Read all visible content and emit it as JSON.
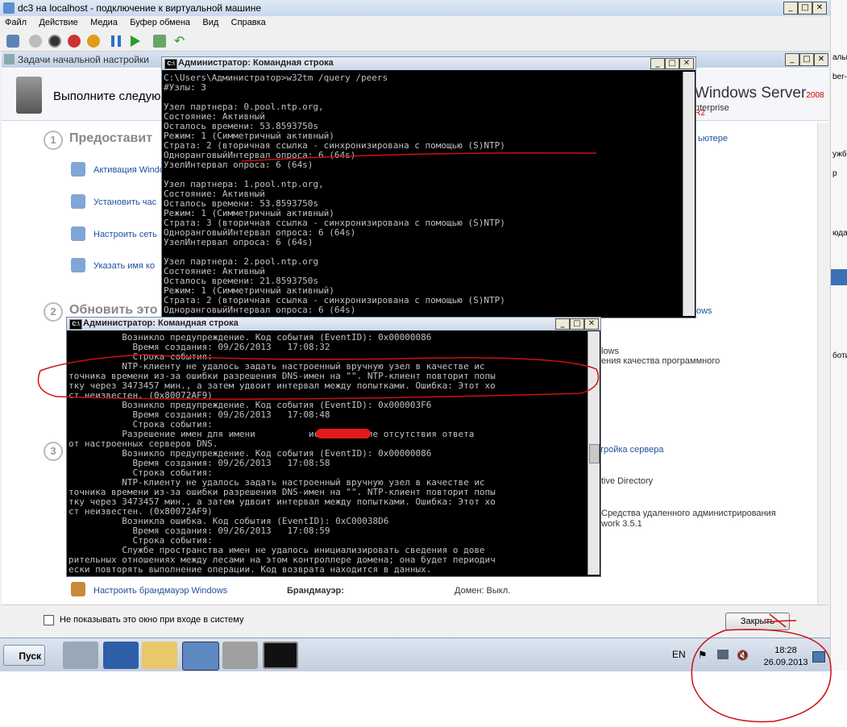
{
  "vm": {
    "title": "dc3 на localhost - подключение к виртуальной машине",
    "menu": [
      "Файл",
      "Действие",
      "Медиа",
      "Буфер обмена",
      "Вид",
      "Справка"
    ]
  },
  "ict": {
    "title": "Задачи начальной настройки",
    "header": "Выполните следую",
    "logo": "Windows Server",
    "logo_ver": "2008 R2",
    "edition": "nterprise",
    "section1": {
      "num": "1",
      "title": "Предоставит"
    },
    "tasks": [
      "Активация Windo",
      "Установить час",
      "Настроить сеть",
      "Указать имя ко"
    ],
    "computer_link": "ьютере",
    "section2": {
      "num": "2",
      "title": "Обновить это"
    },
    "section3": {
      "num": "3"
    },
    "right_items": [
      "ows",
      "lows",
      "ения качества программного",
      "тройка сервера",
      "tive Directory",
      "Средства удаленного администрирования",
      "work 3.5.1"
    ],
    "firewall_link": "Настроить брандмауэр Windows",
    "firewall_label": "Брандмауэр:",
    "firewall_value": "Домен: Выкл.",
    "dont_show": "Не показывать это окно при входе в систему",
    "close_button": "Закрыть"
  },
  "cmd1": {
    "title": "Администратор: Командная строка",
    "lines": [
      "C:\\Users\\Администратор>w32tm /query /peers",
      "#Узлы: 3",
      "",
      "Узел партнера: 0.pool.ntp.org,",
      "Состояние: Активный",
      "Осталось времени: 53.8593750s",
      "Режим: 1 (Симметричный активный)",
      "Страта: 2 (вторичная ссылка - синхронизирована с помощью (S)NTP)",
      "ОдноранговыйИнтервал опроса: 6 (64s)",
      "УзелИнтервал опроса: 6 (64s)",
      "",
      "Узел партнера: 1.pool.ntp.org,",
      "Состояние: Активный",
      "Осталось времени: 53.8593750s",
      "Режим: 1 (Симметричный активный)",
      "Страта: 3 (вторичная ссылка - синхронизирована с помощью (S)NTP)",
      "ОдноранговыйИнтервал опроса: 6 (64s)",
      "УзелИнтервал опроса: 6 (64s)",
      "",
      "Узел партнера: 2.pool.ntp.org",
      "Состояние: Активный",
      "Осталось времени: 21.8593750s",
      "Режим: 1 (Симметричный активный)",
      "Страта: 2 (вторичная ссылка - синхронизирована с помощью (S)NTP)",
      "ОдноранговыйИнтервал опроса: 6 (64s)"
    ]
  },
  "cmd2": {
    "title": "Администратор: Командная строка",
    "lines": [
      "          Возникло предупреждение. Код события (EventID): 0x00000086",
      "            Время создания: 09/26/2013   17:08:32",
      "            Строка события:",
      "          NTP-клиенту не удалось задать настроенный вручную узел в качестве ис",
      "точника времени из-за ошибки разрешения DNS-имен на \"\". NTP-клиент повторит попы",
      "тку через 3473457 мин., а затем удвоит интервал между попытками. Ошибка: Этот хо",
      "ст неизвестен. (0x80072AF9)",
      "          Возникло предупреждение. Код события (EventID): 0x000003F6",
      "            Время создания: 09/26/2013   17:08:48",
      "            Строка события:",
      "          Разрешение имен для имени          истекло после отсутствия ответа",
      "от настроенных серверов DNS.",
      "          Возникло предупреждение. Код события (EventID): 0x00000086",
      "            Время создания: 09/26/2013   17:08:58",
      "            Строка события:",
      "          NTP-клиенту не удалось задать настроенный вручную узел в качестве ис",
      "точника времени из-за ошибки разрешения DNS-имен на \"\". NTP-клиент повторит попы",
      "тку через 3473457 мин., а затем удвоит интервал между попытками. Ошибка: Этот хо",
      "ст неизвестен. (0x80072AF9)",
      "          Возникла ошибка. Код события (EventID): 0xC00038D6",
      "            Время создания: 09/26/2013   17:08:59",
      "            Строка события:",
      "          Службе пространства имен не удалось инициализировать сведения о дове",
      "рительных отношениях между лесами на этом контроллере домена; она будет периодич",
      "ески повторять выполнение операции. Код возврата находится в данных."
    ]
  },
  "taskbar": {
    "start": "Пуск",
    "lang": "EN",
    "time": "18:28",
    "date": "26.09.2013"
  },
  "rightside": [
    "альнс",
    "ber-V",
    "ужб",
    "р",
    "юда",
    "боти"
  ],
  "colors": {
    "annotation": "#cc1111",
    "console_text": "#c0c0c0"
  }
}
